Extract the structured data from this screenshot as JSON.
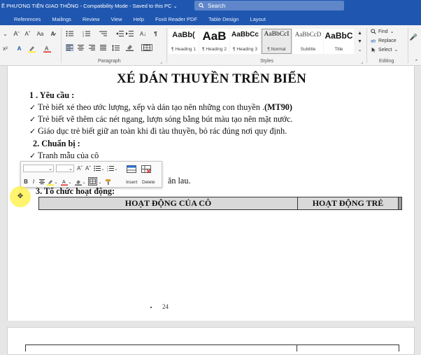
{
  "titlebar": {
    "title": "Ề PHƯƠNG TIỆN GIAO THÔNG - Compatibility Mode - Saved to this PC ⌄",
    "search_placeholder": "Search"
  },
  "tabs": [
    "References",
    "Mailings",
    "Review",
    "View",
    "Help",
    "Foxit Reader PDF",
    "Table Design",
    "Layout"
  ],
  "ribbon": {
    "groups": {
      "paragraph": "Paragraph",
      "styles": "Styles",
      "editing": "Editing"
    },
    "styles": [
      {
        "sample": "AaBb(",
        "name": "¶ Heading 1"
      },
      {
        "sample": "AaB",
        "name": "¶ Heading 2"
      },
      {
        "sample": "AaBbCc",
        "name": "¶ Heading 3"
      },
      {
        "sample": "AaBbCcI",
        "name": "¶ Normal"
      },
      {
        "sample": "AaBbCcD",
        "name": "Subtitle"
      },
      {
        "sample": "AaBbC",
        "name": "Title"
      }
    ],
    "editing": {
      "find": "Find",
      "replace": "Replace",
      "select": "Select"
    }
  },
  "document": {
    "title": "XÉ DÁN THUYỀN TRÊN BIỂN",
    "heading1": "1 . Yêu cầu :",
    "req1_text": "Trẻ biết xé theo ước lượng, xếp và dán tạo nên những con thuyền .",
    "req1_bold": "(MT90)",
    "req2": "Trẻ biết vẽ thêm các nét ngang, lượn sóng bằng bút màu tạo nên mặt nước.",
    "req3": "Giáo dục trẻ biết giữ an toàn khi đi tàu thuyền, bỏ rác đúng nơi quy định.",
    "heading2": "2. Chuẩn bị :",
    "prep1": "Tranh mẫu của cô",
    "prep2_tail": "ăn lau.",
    "heading3": "3. Tổ chức hoạt động:",
    "table": {
      "col1": "HOẠT ĐỘNG CỦA CÔ",
      "col2": "HOẠT ĐỘNG TRẺ"
    },
    "page_number": "24"
  },
  "mini_toolbar": {
    "insert": "Insert",
    "delete": "Delete"
  }
}
